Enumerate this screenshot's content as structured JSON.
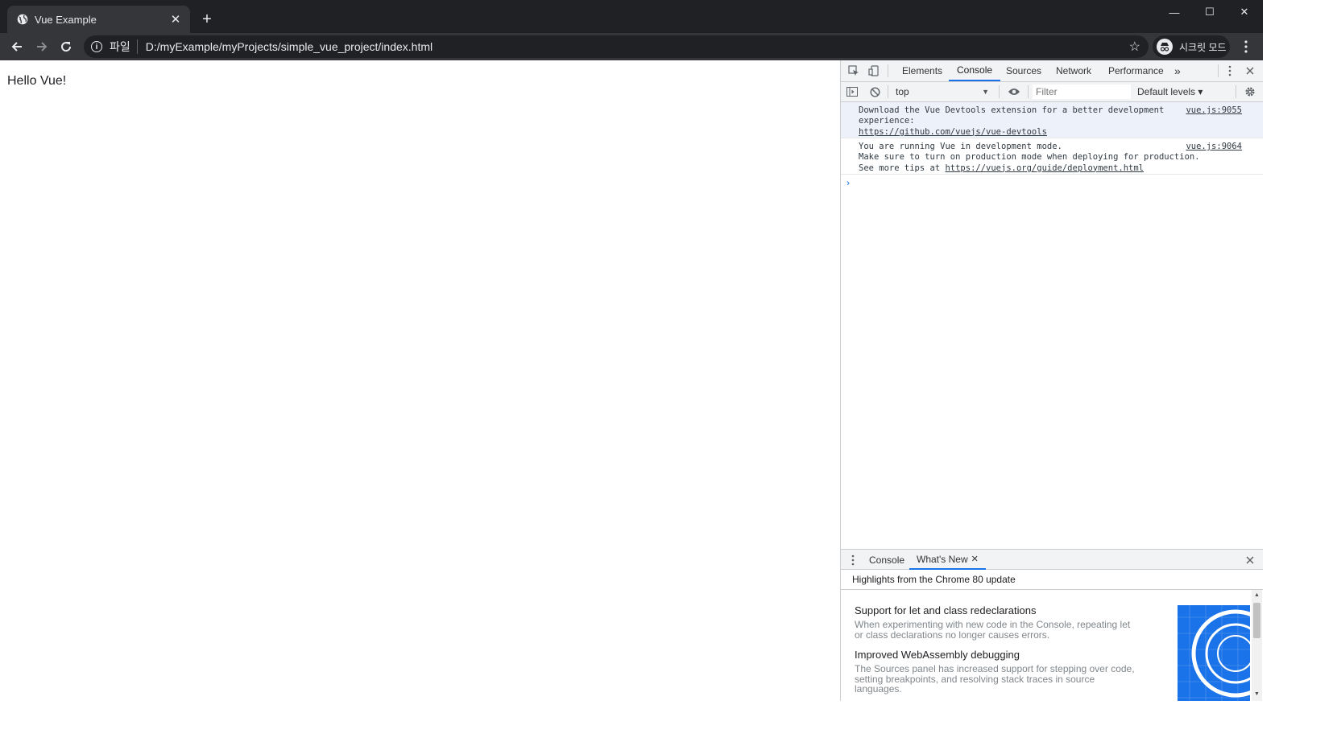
{
  "tab": {
    "title": "Vue Example",
    "close": "✕",
    "new_tab": "+"
  },
  "window_controls": {
    "minimize": "—",
    "maximize": "☐",
    "close": "✕"
  },
  "toolbar": {
    "scheme_label": "파일",
    "url": "D:/myExample/myProjects/simple_vue_project/index.html",
    "incognito_label": "시크릿 모드"
  },
  "page": {
    "hello": "Hello Vue!"
  },
  "devtools": {
    "tabs": [
      "Elements",
      "Console",
      "Sources",
      "Network",
      "Performance"
    ],
    "more_tabs": "»",
    "active_tab": "Console",
    "context": "top",
    "filter_placeholder": "Filter",
    "levels": "Default levels ▾",
    "messages": [
      {
        "line1": "Download the Vue Devtools extension for a better development",
        "line2": "experience:",
        "link": "https://github.com/vuejs/vue-devtools",
        "source": "vue.js:9055"
      },
      {
        "line1": "You are running Vue in development mode.",
        "line2": "Make sure to turn on production mode when deploying for production.",
        "line3_prefix": "See more tips at ",
        "link": "https://vuejs.org/guide/deployment.html",
        "source": "vue.js:9064"
      }
    ],
    "prompt": "›"
  },
  "drawer": {
    "tabs": [
      "Console",
      "What's New"
    ],
    "tab_close": "✕",
    "active_tab": "What's New",
    "highlights": "Highlights from the Chrome 80 update",
    "items": [
      {
        "title": "Support for let and class redeclarations",
        "desc1": "When experimenting with new code in the Console, repeating let",
        "desc2": "or class declarations no longer causes errors."
      },
      {
        "title": "Improved WebAssembly debugging",
        "desc1": "The Sources panel has increased support for stepping over code,",
        "desc2": "setting breakpoints, and resolving stack traces in source",
        "desc3": "languages."
      }
    ],
    "close": "✕"
  },
  "colors": {
    "titlebar": "#202124",
    "active_tab": "#35363a",
    "accent": "#1a73e8"
  }
}
